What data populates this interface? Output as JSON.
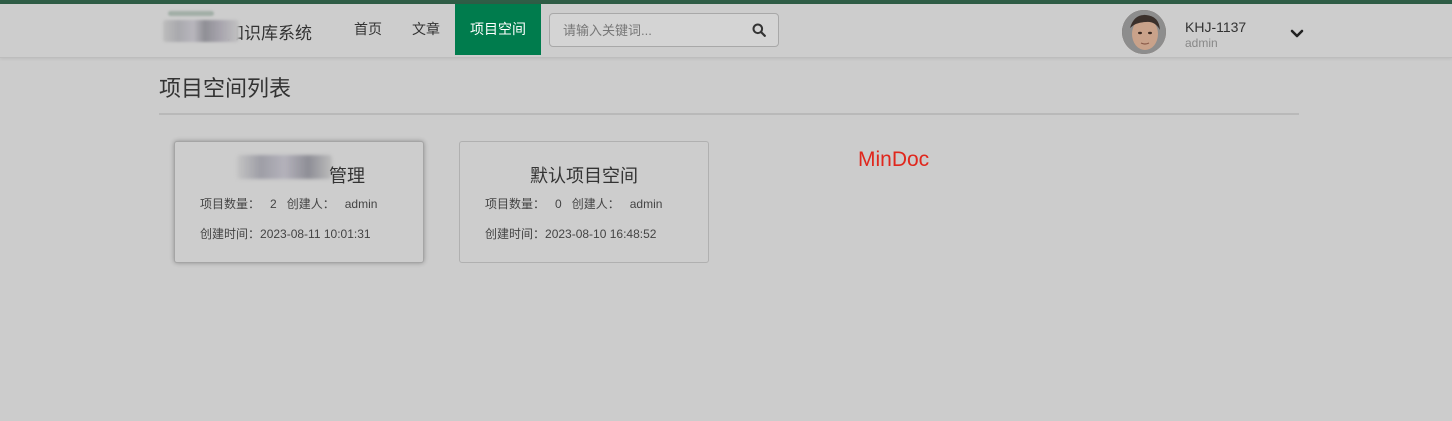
{
  "navbar": {
    "brand_text": "知识库系统",
    "items": [
      {
        "label": "首页"
      },
      {
        "label": "文章"
      },
      {
        "label": "项目空间"
      }
    ],
    "search": {
      "placeholder": "请输入关键词...",
      "icon": "search-icon"
    },
    "user": {
      "name": "KHJ-1137",
      "role": "admin",
      "caret_icon": "chevron-down-icon"
    }
  },
  "page": {
    "title": "项目空间列表"
  },
  "cards": [
    {
      "title": "管理",
      "count_label": "项目数量：",
      "count": "2",
      "creator_label": "创建人：",
      "creator": "admin",
      "time_label": "创建时间：",
      "time": "2023-08-11 10:01:31"
    },
    {
      "title": "默认项目空间",
      "count_label": "项目数量：",
      "count": "0",
      "creator_label": "创建人：",
      "creator": "admin",
      "time_label": "创建时间：",
      "time": "2023-08-10 16:48:52"
    }
  ],
  "watermark": "MinDoc",
  "colors": {
    "active_nav": "#007c4d",
    "top_stripe": "#2f5d46",
    "watermark": "#e0271d"
  }
}
